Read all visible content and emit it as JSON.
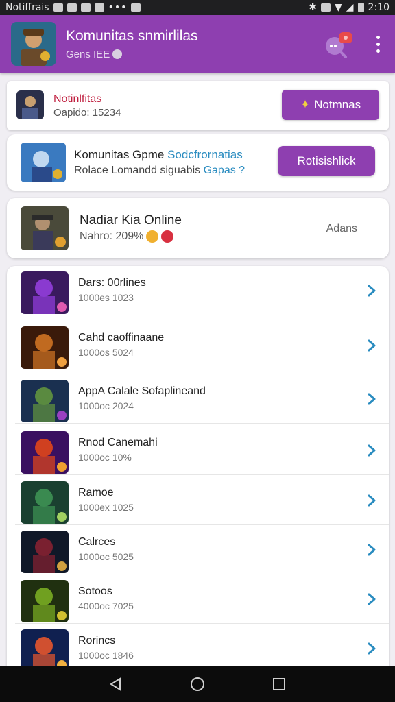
{
  "status": {
    "left_text": "Notiffrais",
    "time": "2:10"
  },
  "header": {
    "title": "Komunitas snmirlilas",
    "subtitle": "Gens IEE"
  },
  "card1": {
    "title": "Notinlfitas",
    "subtitle": "Oapido: 15234",
    "button": "Notmnas"
  },
  "card2": {
    "title_main": "Komunitas Gpme",
    "title_highlight": "Sodcfrornatias",
    "subtitle_main": "Rolace Lomandd siguabis",
    "subtitle_highlight": "Gapas ?",
    "button": "Rotisishlick"
  },
  "card3": {
    "title": "Nadiar Kia Online",
    "subtitle": "Nahro: 209%",
    "side": "Adans"
  },
  "list": [
    {
      "title": "Dars: 00rlines",
      "sub": "1000es 1023",
      "colors": [
        "#3a1a5e",
        "#8a3ad0",
        "#e05ab0"
      ]
    },
    {
      "title": "Cahd caoffinaane",
      "sub": "1000os 5024",
      "colors": [
        "#3a1a0a",
        "#c06a20",
        "#f0a040"
      ]
    },
    {
      "title": "AppA Calale Sofaplineand",
      "sub": "1000oc 2024",
      "colors": [
        "#1a3050",
        "#5a8a40",
        "#9a40c0"
      ]
    },
    {
      "title": "Rnod Canemahi",
      "sub": "1000oc 10%",
      "colors": [
        "#3a1060",
        "#d04020",
        "#f0a030"
      ]
    },
    {
      "title": "Ramoe",
      "sub": "1000ex 1025",
      "colors": [
        "#1a4030",
        "#3a8a50",
        "#a0d060"
      ]
    },
    {
      "title": "Calrces",
      "sub": "1000oc 5025",
      "colors": [
        "#101828",
        "#7a2030",
        "#d0a040"
      ]
    },
    {
      "title": "Sotoos",
      "sub": "4000oc 7025",
      "colors": [
        "#203010",
        "#70a020",
        "#d0c030"
      ]
    },
    {
      "title": "Rorincs",
      "sub": "1000oc 1846",
      "colors": [
        "#102050",
        "#d05030",
        "#f0b040"
      ]
    }
  ],
  "colors": {
    "accent": "#8e3fb0",
    "chevron": "#2a8cc0"
  }
}
